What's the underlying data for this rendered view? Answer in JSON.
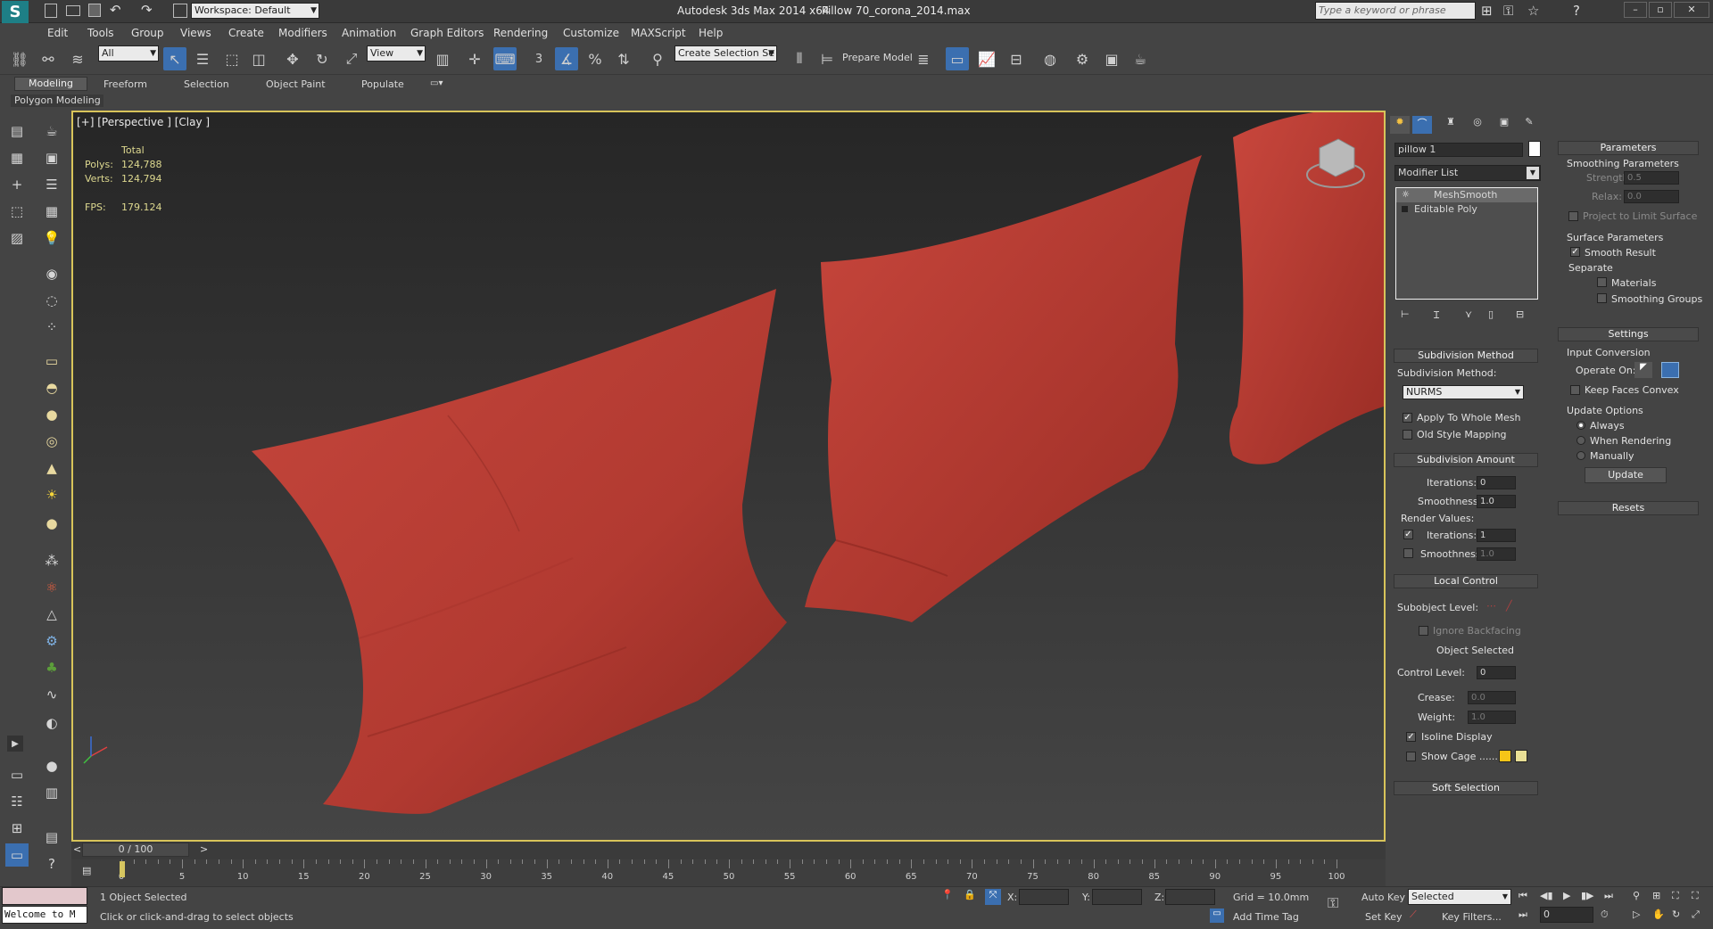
{
  "titlebar": {
    "workspace": "Workspace: Default",
    "app_title": "Autodesk 3ds Max  2014 x64",
    "file_name": "Pillow 70_corona_2014.max",
    "search_placeholder": "Type a keyword or phrase"
  },
  "menu": [
    "Edit",
    "Tools",
    "Group",
    "Views",
    "Create",
    "Modifiers",
    "Animation",
    "Graph Editors",
    "Rendering",
    "Customize",
    "MAXScript",
    "Help"
  ],
  "toolbar": {
    "selection_filter": "All",
    "ref_coord": "View",
    "snap_3": "3",
    "selection_set": "Create Selection Se",
    "prepare_model": "Prepare Model"
  },
  "ribbon": {
    "tabs": [
      "Modeling",
      "Freeform",
      "Selection",
      "Object Paint",
      "Populate"
    ],
    "active_tab": "Modeling",
    "subpanel": "Polygon Modeling"
  },
  "viewport": {
    "label": "[+] [Perspective ] [Clay ]",
    "stats": {
      "total_label": "Total",
      "polys_label": "Polys:",
      "polys": "124,788",
      "verts_label": "Verts:",
      "verts": "124,794",
      "fps_label": "FPS:",
      "fps": "179.124"
    },
    "colors": {
      "background": "#2c2c2c",
      "pillow": "#b0382f",
      "border": "#d8c45a"
    }
  },
  "command_panel": {
    "object_name": "pillow 1",
    "modifier_list": "Modifier List",
    "stack": [
      "MeshSmooth",
      "Editable Poly"
    ],
    "subdivision_method": {
      "header": "Subdivision Method",
      "label": "Subdivision Method:",
      "value": "NURMS",
      "apply_whole": "Apply To Whole Mesh",
      "old_style": "Old Style Mapping"
    },
    "subdivision_amount": {
      "header": "Subdivision Amount",
      "iterations_label": "Iterations:",
      "iterations": "0",
      "smoothness_label": "Smoothness:",
      "smoothness": "1.0",
      "render_values": "Render Values:",
      "r_iterations_label": "Iterations:",
      "r_iterations": "1",
      "r_smoothness_label": "Smoothness:",
      "r_smoothness": "1.0"
    },
    "local_control": {
      "header": "Local Control",
      "subobject_level": "Subobject Level:",
      "ignore_backfacing": "Ignore Backfacing",
      "object_selected": "Object Selected",
      "control_level_label": "Control Level:",
      "control_level": "0",
      "crease_label": "Crease:",
      "crease": "0.0",
      "weight_label": "Weight:",
      "weight": "1.0",
      "isoline": "Isoline Display",
      "show_cage": "Show Cage ......",
      "cage_color1": "#f5c518",
      "cage_color2": "#e9df95"
    },
    "soft_selection": "Soft Selection"
  },
  "modifier_panel": {
    "parameters_header": "Parameters",
    "smoothing_params": "Smoothing Parameters",
    "strength_label": "Strength:",
    "strength": "0.5",
    "relax_label": "Relax:",
    "relax": "0.0",
    "project_limit": "Project to Limit Surface",
    "surface_params": "Surface Parameters",
    "smooth_result": "Smooth Result",
    "separate": "Separate",
    "materials": "Materials",
    "smoothing_groups": "Smoothing Groups",
    "settings_header": "Settings",
    "input_conversion": "Input Conversion",
    "operate_on": "Operate On:",
    "keep_faces_convex": "Keep Faces Convex",
    "update_options": "Update Options",
    "always": "Always",
    "when_rendering": "When Rendering",
    "manually": "Manually",
    "update_button": "Update",
    "resets_header": "Resets"
  },
  "timeline": {
    "frame": "0 / 100",
    "ticks": [
      "0",
      "5",
      "10",
      "15",
      "20",
      "25",
      "30",
      "35",
      "40",
      "45",
      "50",
      "55",
      "60",
      "65",
      "70",
      "75",
      "80",
      "85",
      "90",
      "95",
      "100"
    ]
  },
  "status": {
    "welcome": "Welcome to M",
    "selected": "1 Object Selected",
    "prompt": "Click or click-and-drag to select objects",
    "x_label": "X:",
    "y_label": "Y:",
    "z_label": "Z:",
    "grid": "Grid = 10.0mm",
    "add_time_tag": "Add Time Tag",
    "auto_key": "Auto Key",
    "set_key": "Set Key",
    "key_mode": "Selected",
    "key_filters": "Key Filters...",
    "frame_value": "0"
  }
}
